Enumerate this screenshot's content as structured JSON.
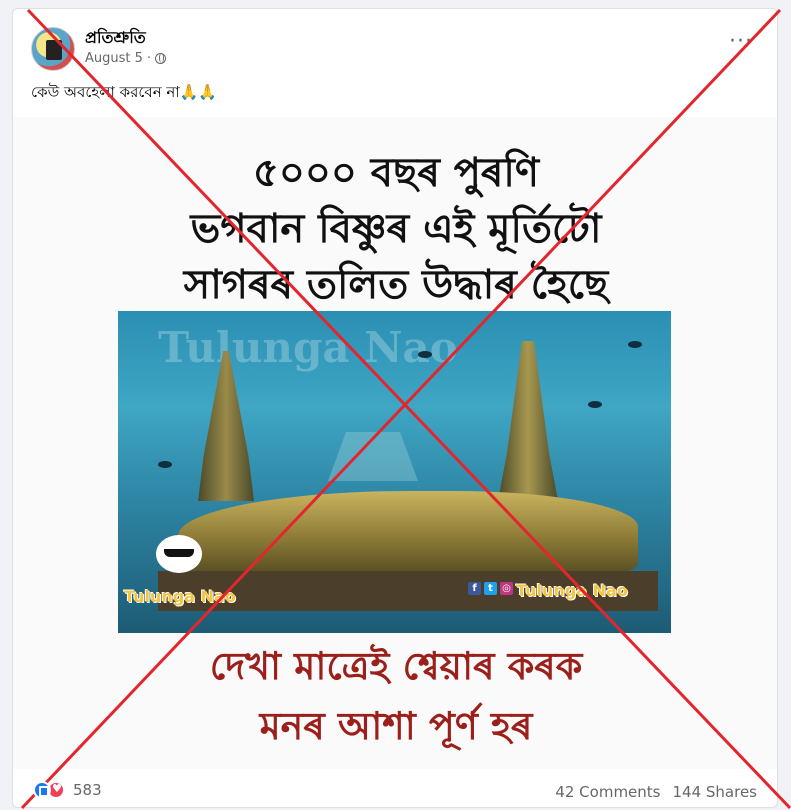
{
  "post": {
    "page_name": "প্ৰতিশ্ৰুতি",
    "date": "August 5",
    "date_separator": "·",
    "more_icon": "more-options-icon",
    "text": "কেউ অবহেলা করবেন না🙏🙏"
  },
  "image": {
    "headline_line1": "৫০০০ বছৰ পুৰণি",
    "headline_line2": "ভগবান বিষ্ণুৰ এই মূৰ্তিটো",
    "headline_line3": "সাগৰৰ তলিত উদ্ধাৰ হৈছে",
    "watermark": "Tulunga Nao",
    "label_left": "Tulunga Nao",
    "label_right": "Tulunga Nao",
    "tagline_line1": "দেখা মাত্ৰেই শ্বেয়াৰ কৰক",
    "tagline_line2": "মনৰ আশা পূৰ্ণ হৰ"
  },
  "footer": {
    "reactions_count": "583",
    "comments": "42 Comments",
    "shares": "144 Shares"
  },
  "colors": {
    "like_blue": "#1877f2",
    "love_red": "#f33e58",
    "cross_red": "#e3262d",
    "tagline_red": "#9b1f1a"
  }
}
